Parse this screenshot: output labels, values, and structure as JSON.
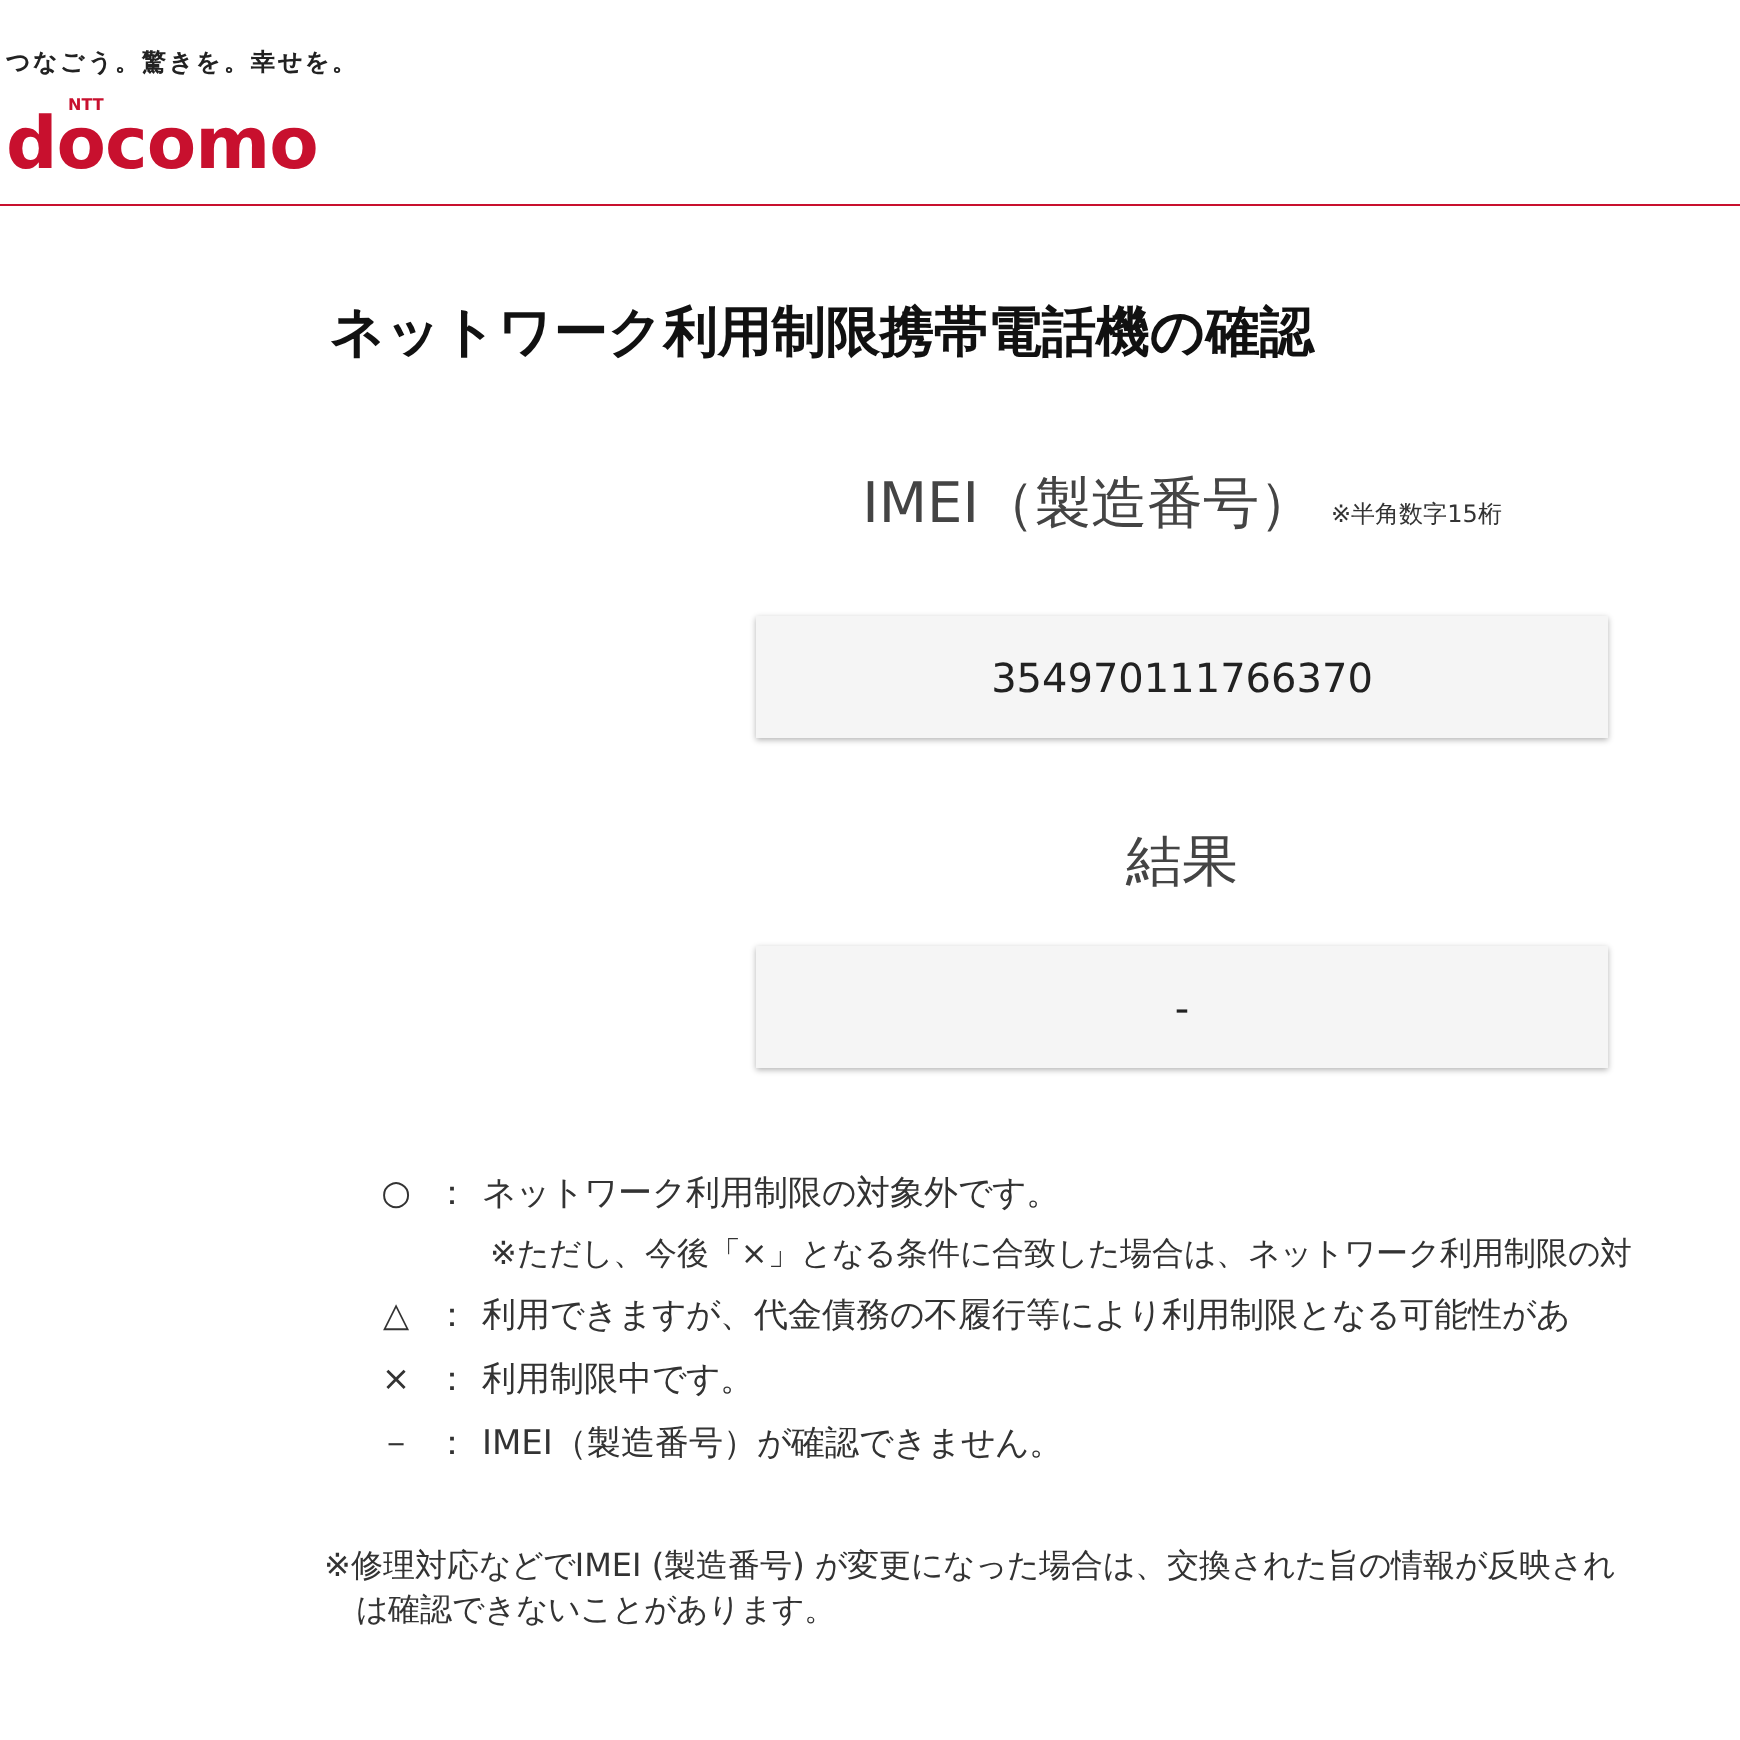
{
  "header": {
    "tagline": "つなごう。驚きを。幸せを。",
    "logo_small": "NTT",
    "logo": "docomo"
  },
  "title": "ネットワーク利用制限携帯電話機の確認",
  "imei": {
    "label": "IMEI（製造番号）",
    "hint": "※半角数字15桁",
    "value": "354970111766370"
  },
  "result": {
    "label": "結果",
    "value": "-"
  },
  "legend": [
    {
      "symbol": "○",
      "separator": "：",
      "text": "ネットワーク利用制限の対象外です。",
      "note": "※ただし、今後「×」となる条件に合致した場合は、ネットワーク利用制限の対"
    },
    {
      "symbol": "△",
      "separator": "：",
      "text": "利用できますが、代金債務の不履行等により利用制限となる可能性があ"
    },
    {
      "symbol": "×",
      "separator": "：",
      "text": "利用制限中です。"
    },
    {
      "symbol": "－",
      "separator": "：",
      "text": "IMEI（製造番号）が確認できません。"
    }
  ],
  "footnote": [
    "※修理対応などでIMEI (製造番号) が変更になった場合は、交換された旨の情報が反映され",
    "は確認できないことがあります。"
  ]
}
